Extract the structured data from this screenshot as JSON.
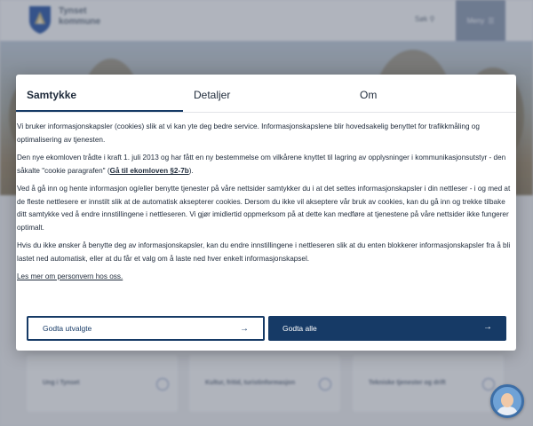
{
  "background": {
    "brand_line1": "Tynset",
    "brand_line2": "kommune",
    "search_label": "Søk",
    "menu_label": "Meny",
    "cards": [
      "Ung i Tynset",
      "Kultur, fritid, turistinformasjon",
      "Tekniske tjenester og drift"
    ]
  },
  "dialog": {
    "tabs": [
      {
        "label": "Samtykke",
        "active": true
      },
      {
        "label": "Detaljer",
        "active": false
      },
      {
        "label": "Om",
        "active": false
      }
    ],
    "paragraphs": {
      "p1": "Vi bruker informasjonskapsler (cookies) slik at vi kan yte deg bedre service. Informasjonskapslene blir hovedsakelig benyttet for trafikkmåling og optimalisering av tjenesten.",
      "p2_before": "Den nye ekomloven trådte i kraft 1. juli 2013 og har fått en ny bestemmelse om vilkårene knyttet til lagring av opplysninger i kommunikasjonsutstyr - den såkalte \"cookie paragrafen\" (",
      "p2_link": "Gå til ekomloven §2-7b",
      "p2_after": ").",
      "p3": "Ved å gå inn og hente informasjon og/eller benytte tjenester på våre nettsider samtykker du i at det settes informasjonskapsler i din nettleser - i og med at de fleste nettlesere er innstilt slik at de automatisk aksepterer cookies. Dersom du ikke vil akseptere vår bruk av cookies, kan du gå inn og trekke tilbake ditt samtykke ved å endre innstillingene i nettleseren. Vi gjør imidlertid oppmerksom på at dette kan medføre at tjenestene på våre nettsider ikke fungerer optimalt.",
      "p4": "Hvis du ikke ønsker å benytte deg av informasjonskapsler, kan du endre innstillingene i nettleseren slik at du enten blokkerer informasjonskapsler fra å bli lastet ned automatisk, eller at du får et valg om å laste ned hver enkelt informasjonskapsel."
    },
    "more_link": "Les mer om personvern hos oss.",
    "buttons": {
      "accept_selected": "Godta utvalgte",
      "accept_all": "Godta alle"
    }
  },
  "colors": {
    "primary": "#163a66",
    "text": "#1e2a3a"
  }
}
